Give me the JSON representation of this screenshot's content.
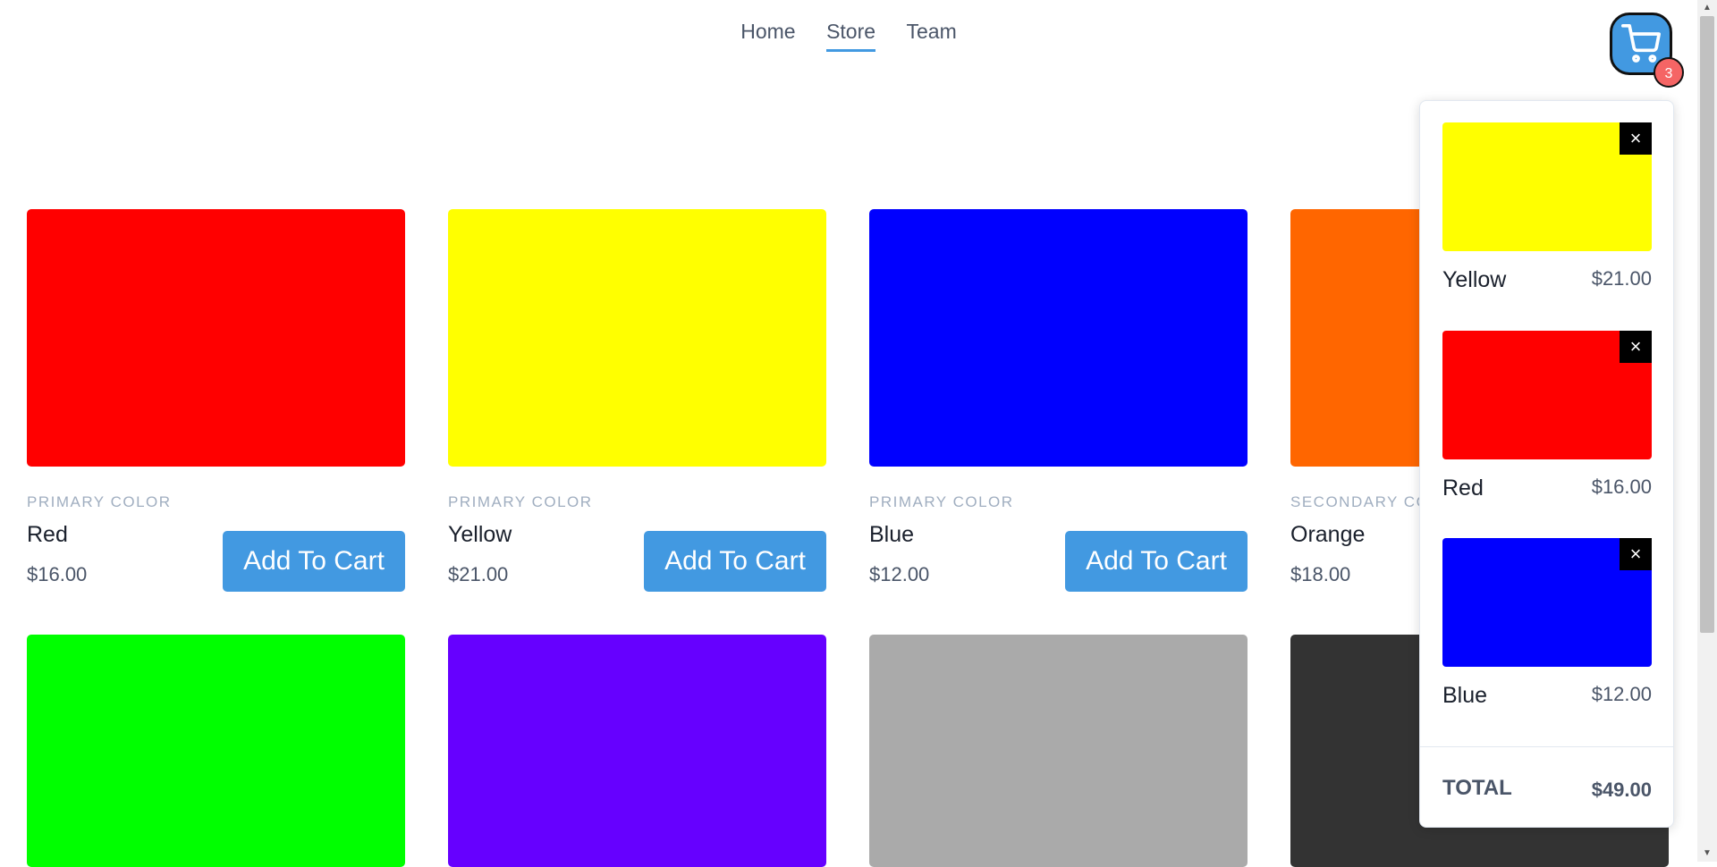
{
  "nav": {
    "home": "Home",
    "store": "Store",
    "team": "Team"
  },
  "cart": {
    "count": "3",
    "icon": "cart-icon"
  },
  "products": [
    {
      "category": "PRIMARY COLOR",
      "name": "Red",
      "price": "$16.00",
      "color": "#ff0000",
      "button": "Add To Cart"
    },
    {
      "category": "PRIMARY COLOR",
      "name": "Yellow",
      "price": "$21.00",
      "color": "#ffff00",
      "button": "Add To Cart"
    },
    {
      "category": "PRIMARY COLOR",
      "name": "Blue",
      "price": "$12.00",
      "color": "#0000ff",
      "button": "Add To Cart"
    },
    {
      "category": "SECONDARY CO",
      "name": "Orange",
      "price": "$18.00",
      "color": "#ff6600"
    },
    {
      "color": "#00ff00"
    },
    {
      "color": "#6600ff"
    },
    {
      "color": "#aaaaaa"
    },
    {
      "color": "#333333"
    }
  ],
  "cart_panel": {
    "items": [
      {
        "name": "Yellow",
        "price": "$21.00",
        "color": "#ffff00",
        "remove": "×"
      },
      {
        "name": "Red",
        "price": "$16.00",
        "color": "#ff0000",
        "remove": "×"
      },
      {
        "name": "Blue",
        "price": "$12.00",
        "color": "#0000ff",
        "remove": "×"
      }
    ],
    "total_label": "TOTAL",
    "total_value": "$49.00"
  }
}
